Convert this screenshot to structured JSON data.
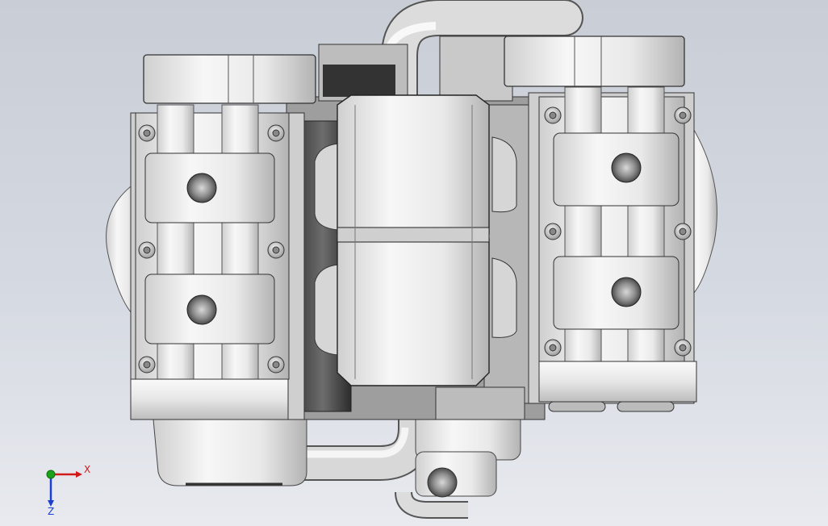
{
  "viewport": {
    "background_top": "#c9cdd6",
    "background_bottom": "#e8eaef"
  },
  "model": {
    "type": "engine-assembly",
    "shaded_with_edges": true
  },
  "triad": {
    "x_label": "X",
    "y_label": "",
    "z_label": "Z",
    "x_color": "#d11919",
    "y_color": "#1aa31a",
    "z_color": "#1a3fd1"
  }
}
